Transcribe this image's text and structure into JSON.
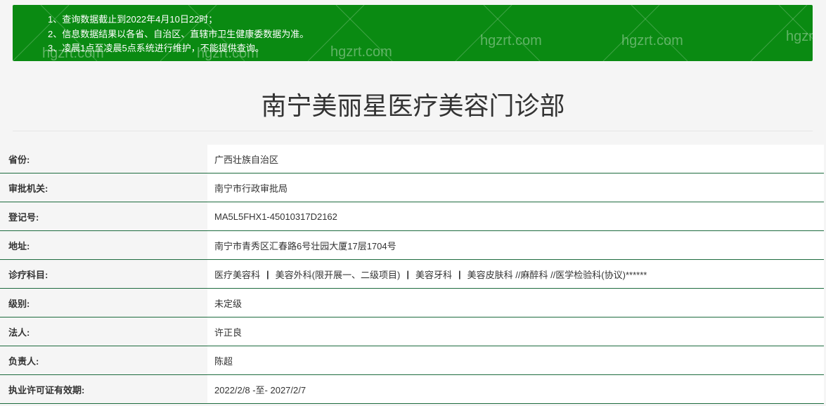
{
  "notice": {
    "lines": [
      "1、查询数据截止到2022年4月10日22时；",
      "2、信息数据结果以各省、自治区、直辖市卫生健康委数据为准。",
      "3、凌晨1点至凌晨5点系统进行维护，不能提供查询。"
    ],
    "bg_color": "#0a8a12",
    "watermark_text": "hgzrt.com"
  },
  "title": "南宁美丽星医疗美容门诊部",
  "rows": [
    {
      "label": "省份:",
      "value": "广西壮族自治区"
    },
    {
      "label": "审批机关:",
      "value": "南宁市行政审批局"
    },
    {
      "label": "登记号:",
      "value": "MA5L5FHX1-45010317D2162"
    },
    {
      "label": "地址:",
      "value": "南宁市青秀区汇春路6号壮园大厦17层1704号"
    },
    {
      "label": "诊疗科目:",
      "items": [
        "医疗美容科",
        "美容外科(限开展一、二级项目)",
        "美容牙科",
        "美容皮肤科 //麻醉科 //医学检验科(协议)******"
      ],
      "separator": "|"
    },
    {
      "label": "级别:",
      "value": "未定级"
    },
    {
      "label": "法人:",
      "value": "许正良"
    },
    {
      "label": "负责人:",
      "value": "陈超"
    },
    {
      "label": "执业许可证有效期:",
      "value": "2022/2/8 -至- 2027/2/7"
    }
  ]
}
